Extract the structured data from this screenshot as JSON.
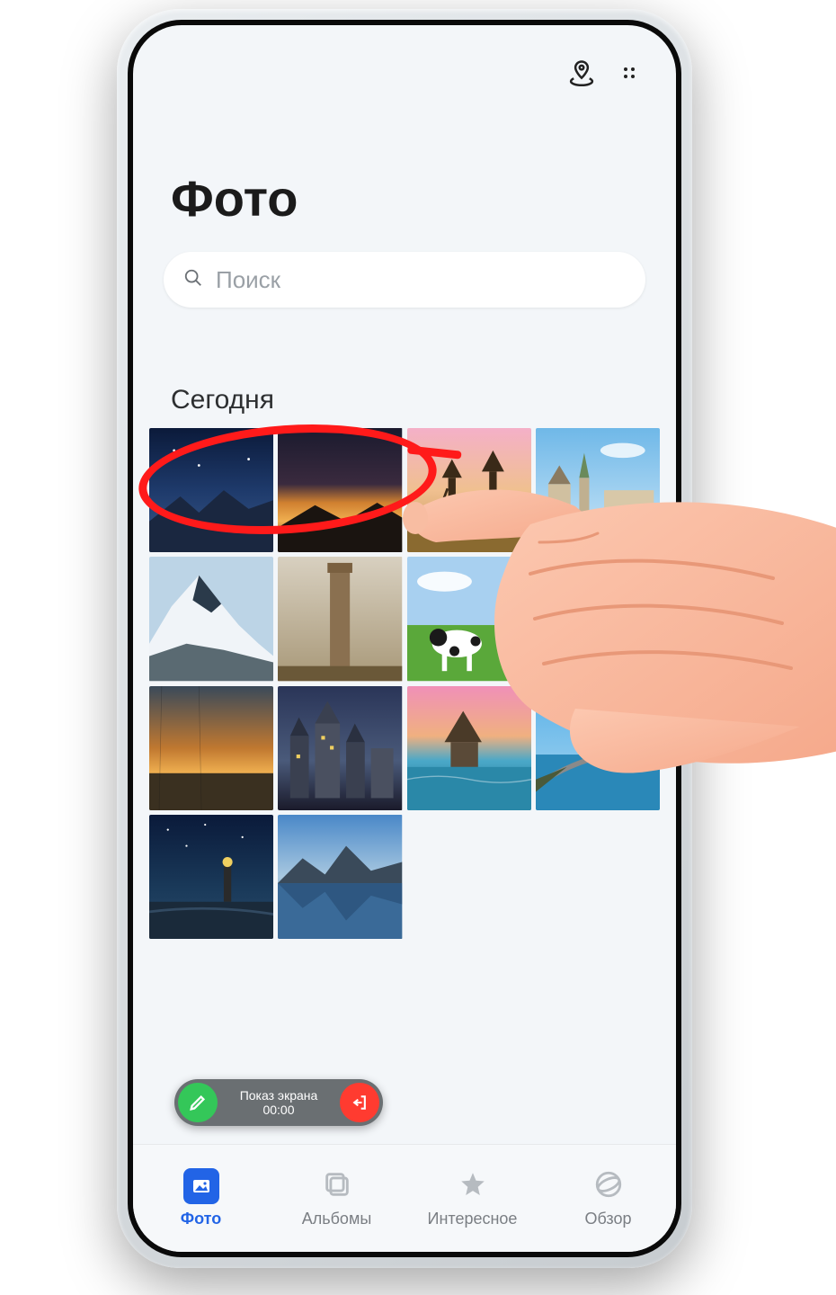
{
  "header": {
    "title": "Фото"
  },
  "search": {
    "placeholder": "Поиск"
  },
  "section": {
    "today_label": "Сегодня"
  },
  "thumbnails": [
    {
      "name": "milky-way-mountains"
    },
    {
      "name": "sunset-horizon-mountains"
    },
    {
      "name": "windmills-field"
    },
    {
      "name": "city-river-cathedral"
    },
    {
      "name": "snowy-peak"
    },
    {
      "name": "desert-pillar"
    },
    {
      "name": "cow-meadow"
    },
    {
      "name": "mountain-sky"
    },
    {
      "name": "rainy-lake-sunset"
    },
    {
      "name": "old-city-dusk"
    },
    {
      "name": "tropical-overwater"
    },
    {
      "name": "coast-road-cliffs"
    },
    {
      "name": "starry-lighthouse"
    },
    {
      "name": "mountain-lake-reflection"
    }
  ],
  "screencast": {
    "label": "Показ экрана",
    "time": "00:00"
  },
  "nav": {
    "items": [
      {
        "label": "Фото",
        "icon": "photos-icon",
        "active": true
      },
      {
        "label": "Альбомы",
        "icon": "albums-icon",
        "active": false
      },
      {
        "label": "Интересное",
        "icon": "star-icon",
        "active": false
      },
      {
        "label": "Обзор",
        "icon": "globe-icon",
        "active": false
      }
    ]
  },
  "colors": {
    "accent": "#2264e6",
    "annotation": "#ff1a1a",
    "pill_green": "#34c759",
    "pill_red": "#ff3b30"
  }
}
